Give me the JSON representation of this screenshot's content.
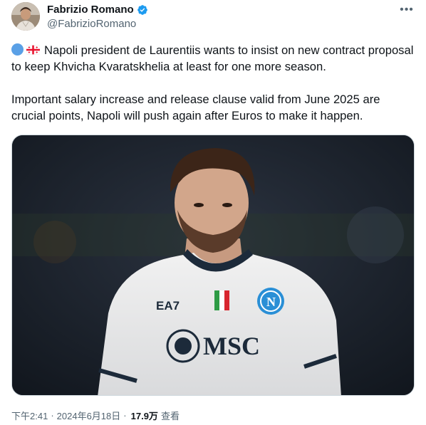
{
  "author": {
    "display_name": "Fabrizio Romano",
    "handle": "@FabrizioRomano",
    "verified": true
  },
  "tweet": {
    "line1_text": "Napoli president de Laurentiis wants to insist on new contract proposal to keep Khvicha Kvaratskhelia at least for one more season.",
    "line2_text": "Important salary increase and release clause valid from June 2025 are crucial points, Napoli will push again after Euros to make it happen.",
    "emoji_1": "blue-circle",
    "emoji_2": "georgia-flag"
  },
  "media": {
    "jersey_sponsor": "MSC",
    "jersey_brand": "EA7",
    "crest_letter": "N"
  },
  "meta": {
    "time": "下午2:41",
    "date": "2024年6月18日",
    "views_count": "17.9万",
    "views_label": "查看"
  },
  "colors": {
    "verified": "#1d9bf0",
    "text": "#0f1419",
    "secondary": "#536471"
  }
}
